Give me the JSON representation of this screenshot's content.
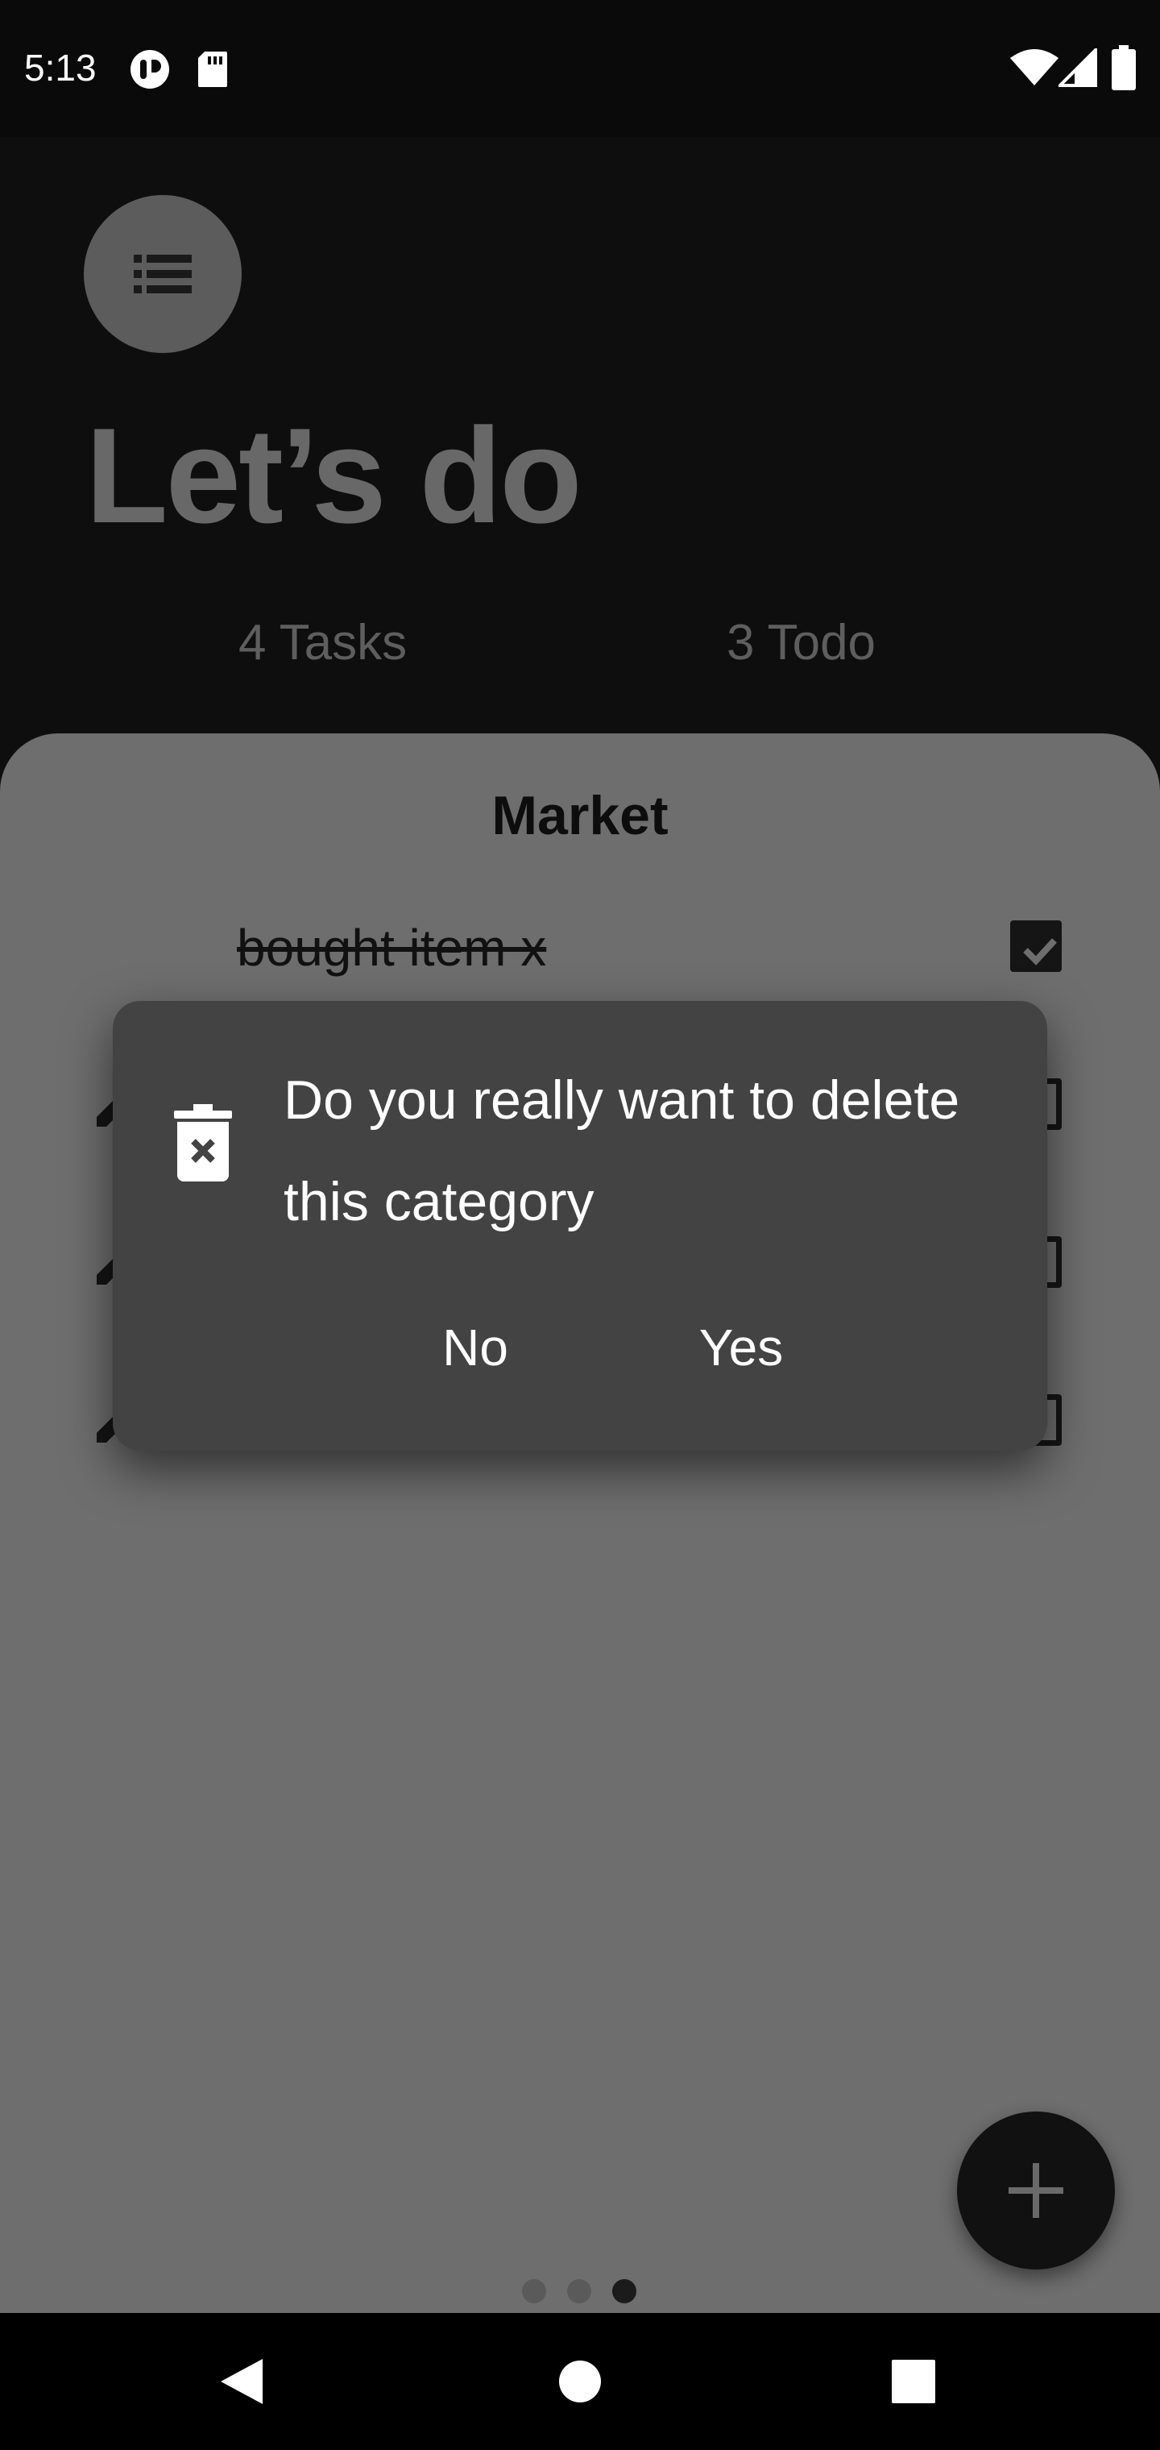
{
  "status_bar": {
    "time": "5:13",
    "left_icons": [
      "podcast-icon",
      "sd-card-icon"
    ],
    "right_icons": [
      "wifi-icon",
      "signal-icon",
      "battery-icon"
    ]
  },
  "header": {
    "menu_icon": "list-icon",
    "title": "Let’s do",
    "tasks_count": "4 Tasks",
    "todo_count": "3 Todo"
  },
  "card": {
    "title": "Market",
    "tasks": [
      {
        "text": "bought item x",
        "done": true
      },
      {
        "text": "",
        "done": false
      },
      {
        "text": "",
        "done": false
      },
      {
        "text": "",
        "done": false
      }
    ]
  },
  "dialog": {
    "icon": "trash-delete-icon",
    "message": "Do you really want to delete this category",
    "no_label": "No",
    "yes_label": "Yes"
  },
  "pager": {
    "pages": 3,
    "active_index": 2
  },
  "fab": {
    "icon": "plus-icon"
  },
  "nav": {
    "back_icon": "back-icon",
    "home_icon": "home-icon",
    "recents_icon": "recents-icon"
  },
  "colors": {
    "dialog_bg": "#434343",
    "card_bg": "#6e6e6e",
    "fab_bg": "#111111"
  }
}
